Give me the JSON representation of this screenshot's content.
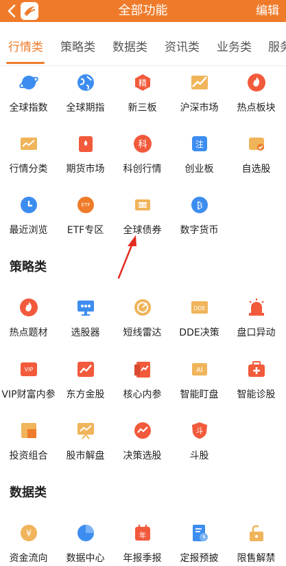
{
  "header": {
    "title": "全部功能",
    "edit_label": "编辑"
  },
  "tabs": [
    {
      "label": "行情类",
      "active": true
    },
    {
      "label": "策略类"
    },
    {
      "label": "数据类"
    },
    {
      "label": "资讯类"
    },
    {
      "label": "业务类"
    },
    {
      "label": "服务"
    }
  ],
  "sections": [
    {
      "title": "",
      "items": [
        {
          "label": "全球指数",
          "icon": "planet-icon"
        },
        {
          "label": "全球期指",
          "icon": "globe-icon"
        },
        {
          "label": "新三板",
          "icon": "jing-badge-icon"
        },
        {
          "label": "沪深市场",
          "icon": "trend-up-icon"
        },
        {
          "label": "热点板块",
          "icon": "flame-icon"
        },
        {
          "label": "行情分类",
          "icon": "chart-folder-icon"
        },
        {
          "label": "期货市场",
          "icon": "oil-barrel-icon"
        },
        {
          "label": "科创行情",
          "icon": "ke-badge-icon"
        },
        {
          "label": "创业板",
          "icon": "zhu-badge-icon"
        },
        {
          "label": "自选股",
          "icon": "watchlist-icon"
        },
        {
          "label": "最近浏览",
          "icon": "clock-icon"
        },
        {
          "label": "ETF专区",
          "icon": "etf-icon"
        },
        {
          "label": "全球债券",
          "icon": "bond-icon"
        },
        {
          "label": "数字货币",
          "icon": "bitcoin-icon"
        }
      ]
    },
    {
      "title": "策略类",
      "items": [
        {
          "label": "热点题材",
          "icon": "flame-icon"
        },
        {
          "label": "选股器",
          "icon": "screen-icon"
        },
        {
          "label": "短线雷达",
          "icon": "radar-icon"
        },
        {
          "label": "DDE决策",
          "icon": "dde-icon"
        },
        {
          "label": "盘口异动",
          "icon": "alarm-icon"
        },
        {
          "label": "VIP财富内参",
          "icon": "vip-icon"
        },
        {
          "label": "东方金股",
          "icon": "trend-chart-icon"
        },
        {
          "label": "核心内参",
          "icon": "report-icon"
        },
        {
          "label": "智能盯盘",
          "icon": "ai-icon"
        },
        {
          "label": "智能诊股",
          "icon": "medkit-icon"
        },
        {
          "label": "投资组合",
          "icon": "portfolio-icon"
        },
        {
          "label": "股市解盘",
          "icon": "board-icon"
        },
        {
          "label": "决策选股",
          "icon": "decision-icon"
        },
        {
          "label": "斗股",
          "icon": "dou-shield-icon"
        }
      ]
    },
    {
      "title": "数据类",
      "items": [
        {
          "label": "资金流向",
          "icon": "yen-coin-icon"
        },
        {
          "label": "数据中心",
          "icon": "pie-icon"
        },
        {
          "label": "年报季报",
          "icon": "calendar-icon"
        },
        {
          "label": "定报预披",
          "icon": "doc-clock-icon"
        },
        {
          "label": "限售解禁",
          "icon": "unlock-icon"
        }
      ]
    }
  ],
  "colors": {
    "accent": "#ef7b2a",
    "blue": "#3d8df0"
  }
}
